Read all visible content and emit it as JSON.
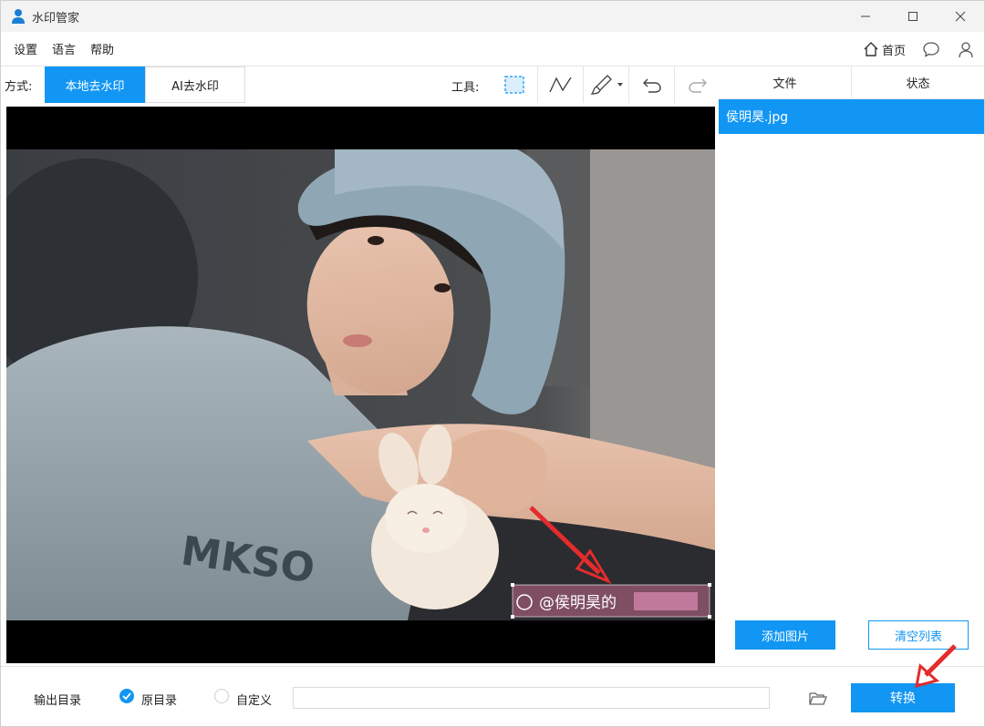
{
  "window": {
    "title": "水印管家"
  },
  "menu": {
    "settings": "设置",
    "language": "语言",
    "help": "帮助",
    "home": "首页"
  },
  "toolbar": {
    "mode_label": "方式:",
    "local_mode": "本地去水印",
    "ai_mode": "AI去水印",
    "tools_label": "工具:"
  },
  "files": {
    "col_file": "文件",
    "col_status": "状态",
    "items": [
      {
        "name": "侯明昊.jpg",
        "status": ""
      }
    ],
    "add_label": "添加图片",
    "clear_label": "清空列表"
  },
  "preview": {
    "watermark_text": "@侯明昊的"
  },
  "output": {
    "label": "输出目录",
    "original": "原目录",
    "custom": "自定义",
    "path_value": "",
    "convert_label": "转换"
  },
  "colors": {
    "accent": "#1196f3",
    "arrow": "#e52b2b"
  }
}
